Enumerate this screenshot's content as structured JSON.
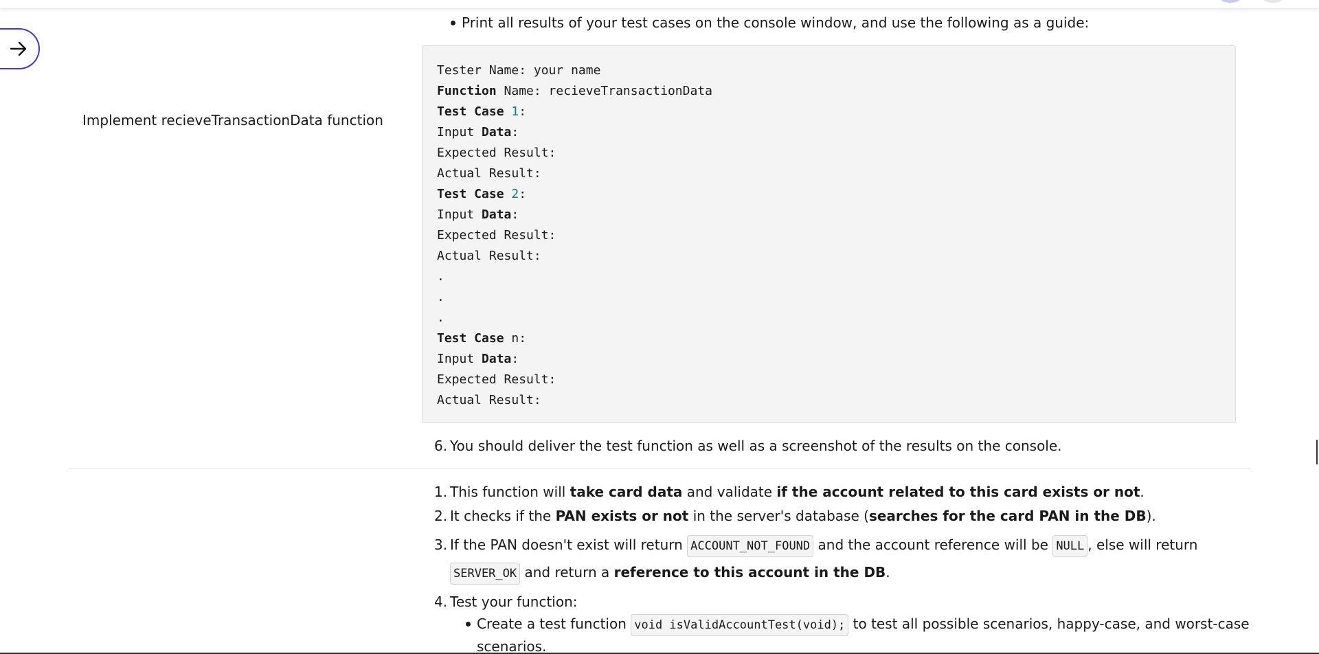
{
  "page": {
    "top_bullet": "Print all results of your test cases on the console window, and use the following as a guide:",
    "left_label": "Implement recieveTransactionData function",
    "code_block": {
      "lines": [
        {
          "a": "Tester Name: your name"
        },
        {
          "kw": "Function",
          "rest": " Name: recieveTransactionData"
        },
        {
          "kw": "Test Case",
          "sp": " ",
          "num": "1",
          "rest": ":"
        },
        {
          "pre": "Input ",
          "kw": "Data",
          "rest": ":"
        },
        {
          "a": "Expected Result:"
        },
        {
          "a": "Actual Result:"
        },
        {
          "kw": "Test Case",
          "sp": " ",
          "num": "2",
          "rest": ":"
        },
        {
          "pre": "Input ",
          "kw": "Data",
          "rest": ":"
        },
        {
          "a": "Expected Result:"
        },
        {
          "a": "Actual Result:"
        },
        {
          "a": "."
        },
        {
          "a": "."
        },
        {
          "a": "."
        },
        {
          "kw": "Test Case",
          "rest": " n:"
        },
        {
          "pre": "Input ",
          "kw": "Data",
          "rest": ":"
        },
        {
          "a": "Expected Result:"
        },
        {
          "a": "Actual Result:"
        }
      ]
    },
    "item6": {
      "num": "6.",
      "text": "You should deliver the test function as well as a screenshot of the results on the console."
    },
    "list2": {
      "item1": {
        "num": "1.",
        "t1": "This function will ",
        "b1": "take card data",
        "t2": " and validate ",
        "b2": "if the account related to this card exists or not",
        "t3": "."
      },
      "item2": {
        "num": "2.",
        "t1": "It checks if the ",
        "b1": "PAN exists or not",
        "t2": " in the server's database (",
        "b2": "searches for the card PAN in the DB",
        "t3": ")."
      },
      "item3": {
        "num": "3.",
        "t1": "If the PAN doesn't exist will return ",
        "c1": "ACCOUNT_NOT_FOUND",
        "t2": " and the account reference will be ",
        "c2": "NULL",
        "t3": ", else will return",
        "c3": "SERVER_OK",
        "t4": " and return a ",
        "b1": "reference to this account in the DB",
        "t5": "."
      },
      "item4": {
        "num": "4.",
        "text": "Test your function:"
      },
      "sub_bullet": {
        "t1": "Create a test function ",
        "c1": "void isValidAccountTest(void);",
        "t2": " to test all possible scenarios, happy-case, and worst-case",
        "t3": "scenarios."
      }
    }
  },
  "icons": {
    "sidebar_toggle": "arrow-right-icon"
  },
  "colors": {
    "accent": "#3b39d8",
    "code_number": "#0a7a85",
    "code_bg": "#f4f4f4"
  }
}
